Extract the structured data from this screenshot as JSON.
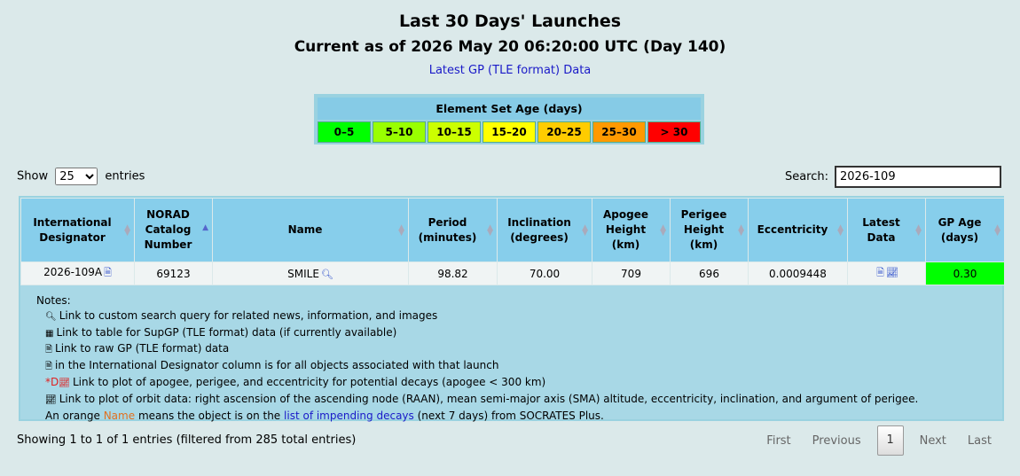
{
  "header": {
    "title": "Last 30 Days' Launches",
    "subtitle": "Current as of 2026 May 20 06:20:00 UTC (Day 140)",
    "link": "Latest GP (TLE format) Data"
  },
  "age_legend": {
    "title": "Element Set Age (days)",
    "cells": [
      {
        "label": "0–5",
        "color": "#00ff00"
      },
      {
        "label": "5–10",
        "color": "#99ff00"
      },
      {
        "label": "10–15",
        "color": "#ccff00"
      },
      {
        "label": "15–20",
        "color": "#ffff00"
      },
      {
        "label": "20–25",
        "color": "#ffcc00"
      },
      {
        "label": "25–30",
        "color": "#ff9900"
      },
      {
        "label": "> 30",
        "color": "#ff0000"
      }
    ]
  },
  "controls": {
    "show_label": "Show",
    "entries_value": "25",
    "entries_label": "entries",
    "search_label": "Search:",
    "search_value": "2026-109"
  },
  "columns": [
    "International Designator",
    "NORAD Catalog Number",
    "Name",
    "Period (minutes)",
    "Inclination (degrees)",
    "Apogee Height (km)",
    "Perigee Height (km)",
    "Eccentricity",
    "Latest Data",
    "GP Age (days)"
  ],
  "rows": [
    {
      "designator": "2026-109A",
      "norad": "69123",
      "name": "SMILE",
      "period": "98.82",
      "inclination": "70.00",
      "apogee": "709",
      "perigee": "696",
      "eccentricity": "0.0009448",
      "gp_age": "0.30"
    }
  ],
  "notes": {
    "title": "Notes:",
    "lines": [
      "Link to custom search query for related news, information, and images",
      "Link to table for SupGP (TLE format) data (if currently available)",
      "Link to raw GP (TLE format) data",
      "in the International Designator column is for all objects associated with that launch",
      "Link to plot of apogee, perigee, and eccentricity for potential decays (apogee < 300 km)",
      "Link to plot of orbit data: right ascension of the ascending node (RAAN), mean semi-major axis (SMA) altitude, eccentricity, inclination, and argument of perigee."
    ],
    "decay_marker": "*D",
    "orange_prefix": "An orange",
    "orange_word": "Name",
    "orange_mid": "means the object is on the",
    "orange_link": "list of impending decays",
    "orange_suffix": "(next 7 days) from SOCRATES Plus."
  },
  "footer": {
    "info": "Showing 1 to 1 of 1 entries (filtered from 285 total entries)",
    "first": "First",
    "previous": "Previous",
    "page": "1",
    "next": "Next",
    "last": "Last"
  }
}
